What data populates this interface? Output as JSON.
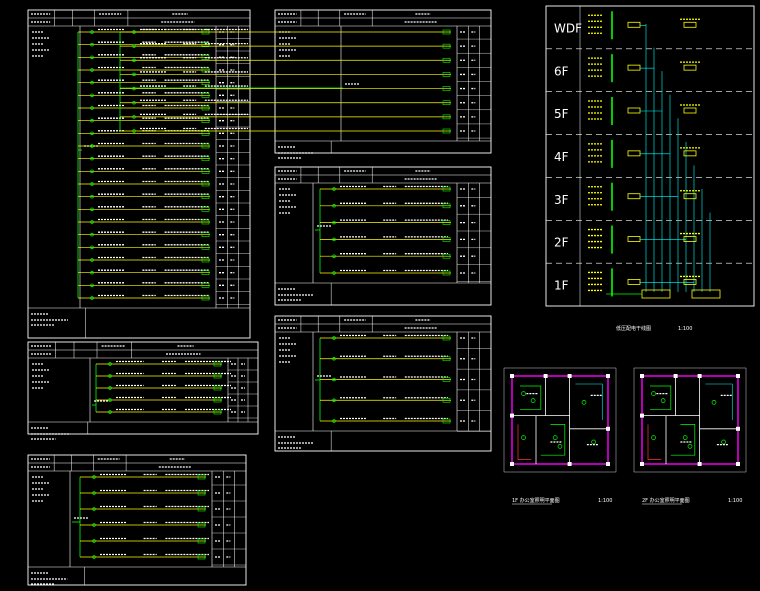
{
  "riser": {
    "floors": [
      "WDF",
      "6F",
      "5F",
      "4F",
      "3F",
      "2F",
      "1F"
    ],
    "caption_left": "低压配电干线图",
    "caption_right": "1:100"
  },
  "plans": {
    "plan1_caption": "1F 办公室照明平面图",
    "plan1_scale": "1:100",
    "plan2_caption": "2F 办公室照明平面图",
    "plan2_scale": "1:100"
  },
  "colors": {
    "background": "#000000",
    "frame": "#ffffff",
    "feeder": "#ffff00",
    "breaker": "#00ff00",
    "riser_line": "#00ffff",
    "label": "#ffffff",
    "wall": "#ff00ff"
  }
}
